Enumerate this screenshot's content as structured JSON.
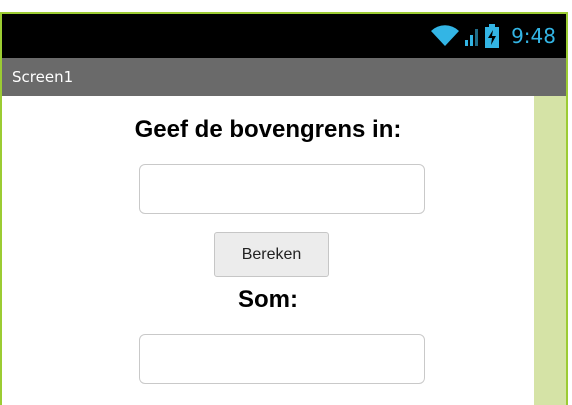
{
  "status_bar": {
    "time": "9:48",
    "icons": [
      "wifi-icon",
      "signal-icon",
      "battery-charging-icon"
    ],
    "accent_color": "#33b5e5"
  },
  "title_bar": {
    "title": "Screen1"
  },
  "form": {
    "upper_bound_label": "Geef de bovengrens in:",
    "upper_bound_value": "",
    "calculate_button": "Bereken",
    "sum_label": "Som:",
    "sum_value": ""
  },
  "colors": {
    "frame_border": "#9ccc33",
    "frame_fill": "#d5e3a6",
    "title_bar_bg": "#6a6a6a"
  }
}
